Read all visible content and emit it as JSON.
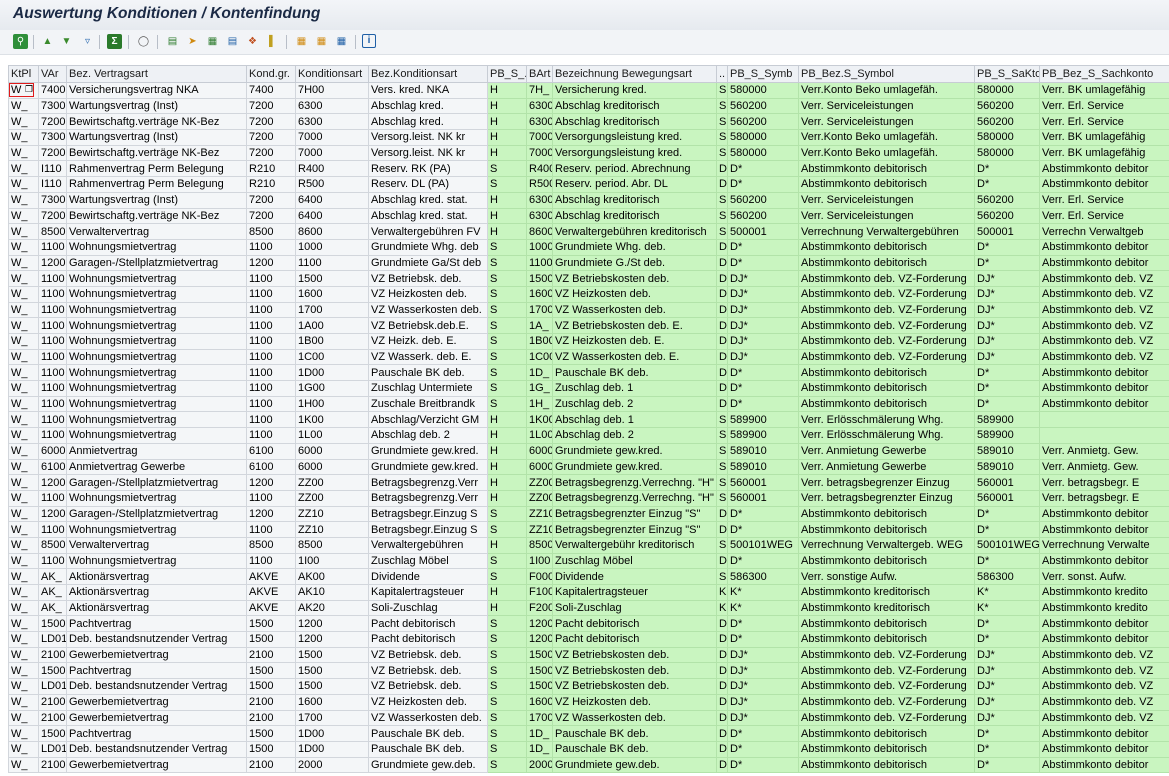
{
  "window": {
    "title": "Auswertung Konditionen / Kontenfindung"
  },
  "toolbar": {
    "icons": [
      "details-icon",
      "sort-asc-icon",
      "sort-desc-icon",
      "filter-icon",
      "sum-icon",
      "subtotal-icon",
      "print-preview-icon",
      "export-icon",
      "spreadsheet-icon",
      "word-processing-icon",
      "local-file-icon",
      "mail-icon",
      "abc-analysis-icon",
      "graphic-icon",
      "change-layout-icon",
      "select-layout-icon",
      "save-layout-icon",
      "info-icon"
    ]
  },
  "table": {
    "columns": [
      "KtPl",
      "VAr",
      "Bez. Vertragsart",
      "Kond.gr.",
      "Konditionsart",
      "Bez.Konditionsart",
      "PB_S_...",
      "BArt",
      "Bezeichnung Bewegungsart",
      "..",
      "PB_S_Symb",
      "PB_Bez.S_Symbol",
      "PB_S_SaKto",
      "PB_Bez_S_Sachkonto"
    ],
    "rows": [
      [
        "W",
        "7400",
        "Versicherungsvertrag NKA",
        "7400",
        "7H00",
        "Vers. kred. NKA",
        "H",
        "7H_",
        "Versicherung kred.",
        "S",
        "580000",
        "Verr.Konto Beko umlagefäh.",
        "580000",
        "Verr. BK umlagefähig"
      ],
      [
        "W_",
        "7300",
        "Wartungsvertrag (Inst)",
        "7200",
        "6300",
        "Abschlag kred.",
        "H",
        "6300",
        "Abschlag kreditorisch",
        "S",
        "560200",
        "Verr. Serviceleistungen",
        "560200",
        "Verr. Erl. Service"
      ],
      [
        "W_",
        "7200",
        "Bewirtschaftg.verträge NK-Bez",
        "7200",
        "6300",
        "Abschlag kred.",
        "H",
        "6300",
        "Abschlag kreditorisch",
        "S",
        "560200",
        "Verr. Serviceleistungen",
        "560200",
        "Verr. Erl. Service"
      ],
      [
        "W_",
        "7300",
        "Wartungsvertrag (Inst)",
        "7200",
        "7000",
        "Versorg.leist. NK kr",
        "H",
        "7000",
        "Versorgungsleistung kred.",
        "S",
        "580000",
        "Verr.Konto Beko umlagefäh.",
        "580000",
        "Verr. BK umlagefähig"
      ],
      [
        "W_",
        "7200",
        "Bewirtschaftg.verträge NK-Bez",
        "7200",
        "7000",
        "Versorg.leist. NK kr",
        "H",
        "7000",
        "Versorgungsleistung kred.",
        "S",
        "580000",
        "Verr.Konto Beko umlagefäh.",
        "580000",
        "Verr. BK umlagefähig"
      ],
      [
        "W_",
        "I110",
        "Rahmenvertrag Perm Belegung",
        "R210",
        "R400",
        "Reserv. RK (PA)",
        "S",
        "R400",
        "Reserv. period. Abrechnung",
        "D",
        "D*",
        "Abstimmkonto debitorisch",
        "D*",
        "Abstimmkonto debitor"
      ],
      [
        "W_",
        "I110",
        "Rahmenvertrag Perm Belegung",
        "R210",
        "R500",
        "Reserv. DL (PA)",
        "S",
        "R500",
        "Reserv. period. Abr. DL",
        "D",
        "D*",
        "Abstimmkonto debitorisch",
        "D*",
        "Abstimmkonto debitor"
      ],
      [
        "W_",
        "7300",
        "Wartungsvertrag (Inst)",
        "7200",
        "6400",
        "Abschlag kred. stat.",
        "H",
        "6300",
        "Abschlag kreditorisch",
        "S",
        "560200",
        "Verr. Serviceleistungen",
        "560200",
        "Verr. Erl. Service"
      ],
      [
        "W_",
        "7200",
        "Bewirtschaftg.verträge NK-Bez",
        "7200",
        "6400",
        "Abschlag kred. stat.",
        "H",
        "6300",
        "Abschlag kreditorisch",
        "S",
        "560200",
        "Verr. Serviceleistungen",
        "560200",
        "Verr. Erl. Service"
      ],
      [
        "W_",
        "8500",
        "Verwaltervertrag",
        "8500",
        "8600",
        "Verwaltergebühren FV",
        "H",
        "8600",
        "Verwaltergebühren kreditorisch",
        "S",
        "500001",
        "Verrechnung Verwaltergebühren",
        "500001",
        "Verrechn Verwaltgeb"
      ],
      [
        "W_",
        "1100",
        "Wohnungsmietvertrag",
        "1100",
        "1000",
        "Grundmiete Whg. deb",
        "S",
        "1000",
        "Grundmiete Whg. deb.",
        "D",
        "D*",
        "Abstimmkonto debitorisch",
        "D*",
        "Abstimmkonto debitor"
      ],
      [
        "W_",
        "1200",
        "Garagen-/Stellplatzmietvertrag",
        "1200",
        "1100",
        "Grundmiete Ga/St deb",
        "S",
        "1100",
        "Grundmiete G./St deb.",
        "D",
        "D*",
        "Abstimmkonto debitorisch",
        "D*",
        "Abstimmkonto debitor"
      ],
      [
        "W_",
        "1100",
        "Wohnungsmietvertrag",
        "1100",
        "1500",
        "VZ Betriebsk. deb.",
        "S",
        "1500",
        "VZ Betriebskosten deb.",
        "D",
        "DJ*",
        "Abstimmkonto deb. VZ-Forderung",
        "DJ*",
        "Abstimmkonto deb. VZ"
      ],
      [
        "W_",
        "1100",
        "Wohnungsmietvertrag",
        "1100",
        "1600",
        "VZ Heizkosten deb.",
        "S",
        "1600",
        "VZ Heizkosten deb.",
        "D",
        "DJ*",
        "Abstimmkonto deb. VZ-Forderung",
        "DJ*",
        "Abstimmkonto deb. VZ"
      ],
      [
        "W_",
        "1100",
        "Wohnungsmietvertrag",
        "1100",
        "1700",
        "VZ Wasserkosten deb.",
        "S",
        "1700",
        "VZ Wasserkosten deb.",
        "D",
        "DJ*",
        "Abstimmkonto deb. VZ-Forderung",
        "DJ*",
        "Abstimmkonto deb. VZ"
      ],
      [
        "W_",
        "1100",
        "Wohnungsmietvertrag",
        "1100",
        "1A00",
        "VZ Betriebsk.deb.E.",
        "S",
        "1A_",
        "VZ Betriebskosten deb. E.",
        "D",
        "DJ*",
        "Abstimmkonto deb. VZ-Forderung",
        "DJ*",
        "Abstimmkonto deb. VZ"
      ],
      [
        "W_",
        "1100",
        "Wohnungsmietvertrag",
        "1100",
        "1B00",
        "VZ Heizk. deb. E.",
        "S",
        "1B00",
        "VZ Heizkosten deb. E.",
        "D",
        "DJ*",
        "Abstimmkonto deb. VZ-Forderung",
        "DJ*",
        "Abstimmkonto deb. VZ"
      ],
      [
        "W_",
        "1100",
        "Wohnungsmietvertrag",
        "1100",
        "1C00",
        "VZ Wasserk. deb. E.",
        "S",
        "1C00",
        "VZ Wasserkosten deb. E.",
        "D",
        "DJ*",
        "Abstimmkonto deb. VZ-Forderung",
        "DJ*",
        "Abstimmkonto deb. VZ"
      ],
      [
        "W_",
        "1100",
        "Wohnungsmietvertrag",
        "1100",
        "1D00",
        "Pauschale BK deb.",
        "S",
        "1D_",
        "Pauschale BK deb.",
        "D",
        "D*",
        "Abstimmkonto debitorisch",
        "D*",
        "Abstimmkonto debitor"
      ],
      [
        "W_",
        "1100",
        "Wohnungsmietvertrag",
        "1100",
        "1G00",
        "Zuschlag Untermiete",
        "S",
        "1G_",
        "Zuschlag deb. 1",
        "D",
        "D*",
        "Abstimmkonto debitorisch",
        "D*",
        "Abstimmkonto debitor"
      ],
      [
        "W_",
        "1100",
        "Wohnungsmietvertrag",
        "1100",
        "1H00",
        "Zuschale Breitbrandk",
        "S",
        "1H_",
        "Zuschlag deb. 2",
        "D",
        "D*",
        "Abstimmkonto debitorisch",
        "D*",
        "Abstimmkonto debitor"
      ],
      [
        "W_",
        "1100",
        "Wohnungsmietvertrag",
        "1100",
        "1K00",
        "Abschlag/Verzicht GM",
        "H",
        "1K00",
        "Abschlag deb. 1",
        "S",
        "589900",
        "Verr. Erlösschmälerung Whg.",
        "589900",
        ""
      ],
      [
        "W_",
        "1100",
        "Wohnungsmietvertrag",
        "1100",
        "1L00",
        "Abschlag deb. 2",
        "H",
        "1L00",
        "Abschlag deb. 2",
        "S",
        "589900",
        "Verr. Erlösschmälerung Whg.",
        "589900",
        ""
      ],
      [
        "W_",
        "6000",
        "Anmietvertrag",
        "6100",
        "6000",
        "Grundmiete gew.kred.",
        "H",
        "6000",
        "Grundmiete gew.kred.",
        "S",
        "589010",
        "Verr. Anmietung Gewerbe",
        "589010",
        "Verr. Anmietg. Gew."
      ],
      [
        "W_",
        "6100",
        "Anmietvertrag Gewerbe",
        "6100",
        "6000",
        "Grundmiete gew.kred.",
        "H",
        "6000",
        "Grundmiete gew.kred.",
        "S",
        "589010",
        "Verr. Anmietung Gewerbe",
        "589010",
        "Verr. Anmietg. Gew."
      ],
      [
        "W_",
        "1200",
        "Garagen-/Stellplatzmietvertrag",
        "1200",
        "ZZ00",
        "Betragsbegrenzg.Verr",
        "H",
        "ZZ00",
        "Betragsbegrenzg.Verrechng. \"H\"",
        "S",
        "560001",
        "Verr. betragsbegrenzer Einzug",
        "560001",
        "Verr. betragsbegr. E"
      ],
      [
        "W_",
        "1100",
        "Wohnungsmietvertrag",
        "1100",
        "ZZ00",
        "Betragsbegrenzg.Verr",
        "H",
        "ZZ00",
        "Betragsbegrenzg.Verrechng. \"H\"",
        "S",
        "560001",
        "Verr. betragsbegrenzter Einzug",
        "560001",
        "Verr. betragsbegr. E"
      ],
      [
        "W_",
        "1200",
        "Garagen-/Stellplatzmietvertrag",
        "1200",
        "ZZ10",
        "Betragsbegr.Einzug S",
        "S",
        "ZZ10",
        "Betragsbegrenzter Einzug \"S\"",
        "D",
        "D*",
        "Abstimmkonto debitorisch",
        "D*",
        "Abstimmkonto debitor"
      ],
      [
        "W_",
        "1100",
        "Wohnungsmietvertrag",
        "1100",
        "ZZ10",
        "Betragsbegr.Einzug S",
        "S",
        "ZZ10",
        "Betragsbegrenzter Einzug \"S\"",
        "D",
        "D*",
        "Abstimmkonto debitorisch",
        "D*",
        "Abstimmkonto debitor"
      ],
      [
        "W_",
        "8500",
        "Verwaltervertrag",
        "8500",
        "8500",
        "Verwaltergebühren",
        "H",
        "8500",
        "Verwaltergebühr kreditorisch",
        "S",
        "500101WEG",
        "Verrechnung Verwaltergeb. WEG",
        "500101WEG",
        "Verrechnung Verwalte"
      ],
      [
        "W_",
        "1100",
        "Wohnungsmietvertrag",
        "1100",
        "1I00",
        "Zuschlag Möbel",
        "S",
        "1I00",
        "Zuschlag Möbel",
        "D",
        "D*",
        "Abstimmkonto debitorisch",
        "D*",
        "Abstimmkonto debitor"
      ],
      [
        "W_",
        "AK_",
        "Aktionärsvertrag",
        "AKVE",
        "AK00",
        "Dividende",
        "S",
        "F000",
        "Dividende",
        "S",
        "586300",
        "Verr. sonstige Aufw.",
        "586300",
        "Verr. sonst. Aufw."
      ],
      [
        "W_",
        "AK_",
        "Aktionärsvertrag",
        "AKVE",
        "AK10",
        "Kapitalertragsteuer",
        "H",
        "F100",
        "Kapitalertragsteuer",
        "K",
        "K*",
        "Abstimmkonto kreditorisch",
        "K*",
        "Abstimmkonto kredito"
      ],
      [
        "W_",
        "AK_",
        "Aktionärsvertrag",
        "AKVE",
        "AK20",
        "Soli-Zuschlag",
        "H",
        "F200",
        "Soli-Zuschlag",
        "K",
        "K*",
        "Abstimmkonto kreditorisch",
        "K*",
        "Abstimmkonto kredito"
      ],
      [
        "W_",
        "1500",
        "Pachtvertrag",
        "1500",
        "1200",
        "Pacht debitorisch",
        "S",
        "1200",
        "Pacht debitorisch",
        "D",
        "D*",
        "Abstimmkonto debitorisch",
        "D*",
        "Abstimmkonto debitor"
      ],
      [
        "W_",
        "LD01",
        "Deb. bestandsnutzender Vertrag",
        "1500",
        "1200",
        "Pacht debitorisch",
        "S",
        "1200",
        "Pacht debitorisch",
        "D",
        "D*",
        "Abstimmkonto debitorisch",
        "D*",
        "Abstimmkonto debitor"
      ],
      [
        "W_",
        "2100",
        "Gewerbemietvertrag",
        "2100",
        "1500",
        "VZ Betriebsk. deb.",
        "S",
        "1500",
        "VZ Betriebskosten deb.",
        "D",
        "DJ*",
        "Abstimmkonto deb. VZ-Forderung",
        "DJ*",
        "Abstimmkonto deb. VZ"
      ],
      [
        "W_",
        "1500",
        "Pachtvertrag",
        "1500",
        "1500",
        "VZ Betriebsk. deb.",
        "S",
        "1500",
        "VZ Betriebskosten deb.",
        "D",
        "DJ*",
        "Abstimmkonto deb. VZ-Forderung",
        "DJ*",
        "Abstimmkonto deb. VZ"
      ],
      [
        "W_",
        "LD01",
        "Deb. bestandsnutzender Vertrag",
        "1500",
        "1500",
        "VZ Betriebsk. deb.",
        "S",
        "1500",
        "VZ Betriebskosten deb.",
        "D",
        "DJ*",
        "Abstimmkonto deb. VZ-Forderung",
        "DJ*",
        "Abstimmkonto deb. VZ"
      ],
      [
        "W_",
        "2100",
        "Gewerbemietvertrag",
        "2100",
        "1600",
        "VZ Heizkosten deb.",
        "S",
        "1600",
        "VZ Heizkosten deb.",
        "D",
        "DJ*",
        "Abstimmkonto deb. VZ-Forderung",
        "DJ*",
        "Abstimmkonto deb. VZ"
      ],
      [
        "W_",
        "2100",
        "Gewerbemietvertrag",
        "2100",
        "1700",
        "VZ Wasserkosten deb.",
        "S",
        "1700",
        "VZ Wasserkosten deb.",
        "D",
        "DJ*",
        "Abstimmkonto deb. VZ-Forderung",
        "DJ*",
        "Abstimmkonto deb. VZ"
      ],
      [
        "W_",
        "1500",
        "Pachtvertrag",
        "1500",
        "1D00",
        "Pauschale BK deb.",
        "S",
        "1D_",
        "Pauschale BK deb.",
        "D",
        "D*",
        "Abstimmkonto debitorisch",
        "D*",
        "Abstimmkonto debitor"
      ],
      [
        "W_",
        "LD01",
        "Deb. bestandsnutzender Vertrag",
        "1500",
        "1D00",
        "Pauschale BK deb.",
        "S",
        "1D_",
        "Pauschale BK deb.",
        "D",
        "D*",
        "Abstimmkonto debitorisch",
        "D*",
        "Abstimmkonto debitor"
      ],
      [
        "W_",
        "2100",
        "Gewerbemietvertrag",
        "2100",
        "2000",
        "Grundmiete gew.deb.",
        "S",
        "2000",
        "Grundmiete gew.deb.",
        "D",
        "D*",
        "Abstimmkonto debitorisch",
        "D*",
        "Abstimmkonto debitor"
      ]
    ]
  }
}
